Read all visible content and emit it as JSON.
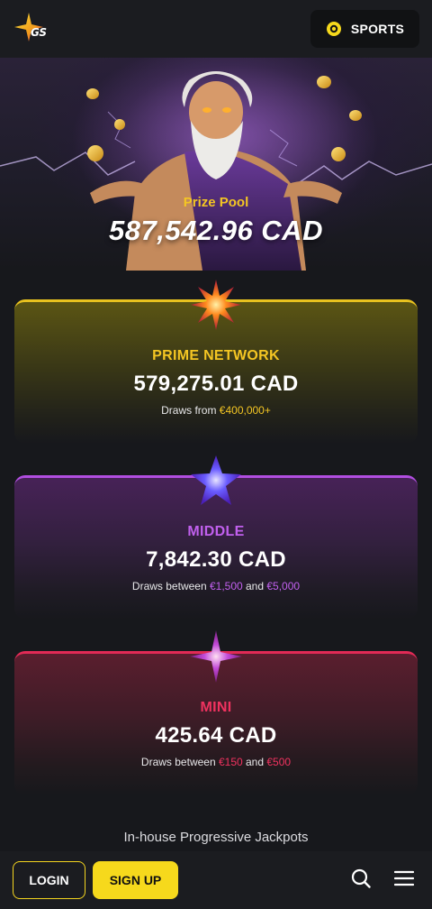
{
  "header": {
    "logo_text": "GS",
    "sports_label": "SPORTS"
  },
  "hero": {
    "prize_label": "Prize Pool",
    "prize_value": "587,542.96 CAD"
  },
  "tiers": [
    {
      "name": "PRIME NETWORK",
      "value": "579,275.01 CAD",
      "desc_prefix": "Draws from ",
      "desc_amount1": "€400,000+",
      "desc_mid": "",
      "desc_amount2": "",
      "accent": "#f4c623"
    },
    {
      "name": "MIDDLE",
      "value": "7,842.30 CAD",
      "desc_prefix": "Draws between ",
      "desc_amount1": "€1,500",
      "desc_mid": " and ",
      "desc_amount2": "€5,000",
      "accent": "#c160ee"
    },
    {
      "name": "MINI",
      "value": "425.64 CAD",
      "desc_prefix": "Draws between ",
      "desc_amount1": "€150",
      "desc_mid": " and ",
      "desc_amount2": "€500",
      "accent": "#f0325f"
    }
  ],
  "footer_caption": "In-house Progressive Jackpots",
  "bottom_bar": {
    "login_label": "LOGIN",
    "signup_label": "SIGN UP",
    "icons": [
      "search-icon",
      "menu-icon"
    ]
  },
  "colors": {
    "background": "#17181c",
    "bar": "#1b1c20",
    "brand_yellow": "#f6d91c"
  }
}
